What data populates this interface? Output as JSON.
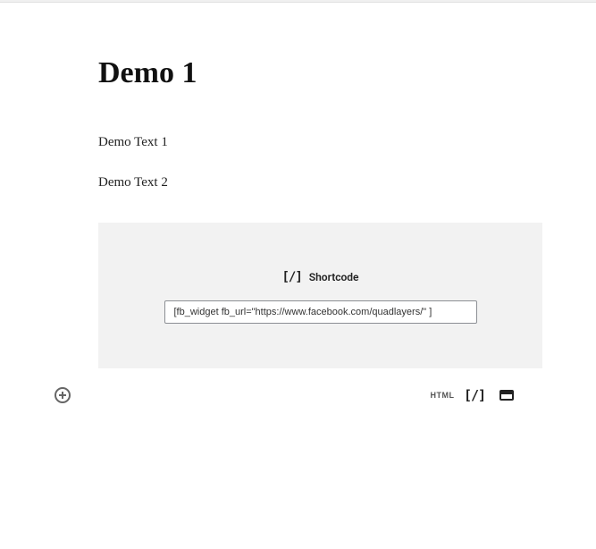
{
  "page": {
    "title": "Demo 1",
    "paragraphs": [
      "Demo Text 1",
      "Demo Text 2"
    ]
  },
  "shortcode_block": {
    "label": "Shortcode",
    "icon_glyph": "[/]",
    "value": "[fb_widget fb_url=\"https://www.facebook.com/quadlayers/\" ]"
  },
  "toolbar": {
    "html_label": "HTML",
    "shortcode_glyph": "[/]"
  }
}
